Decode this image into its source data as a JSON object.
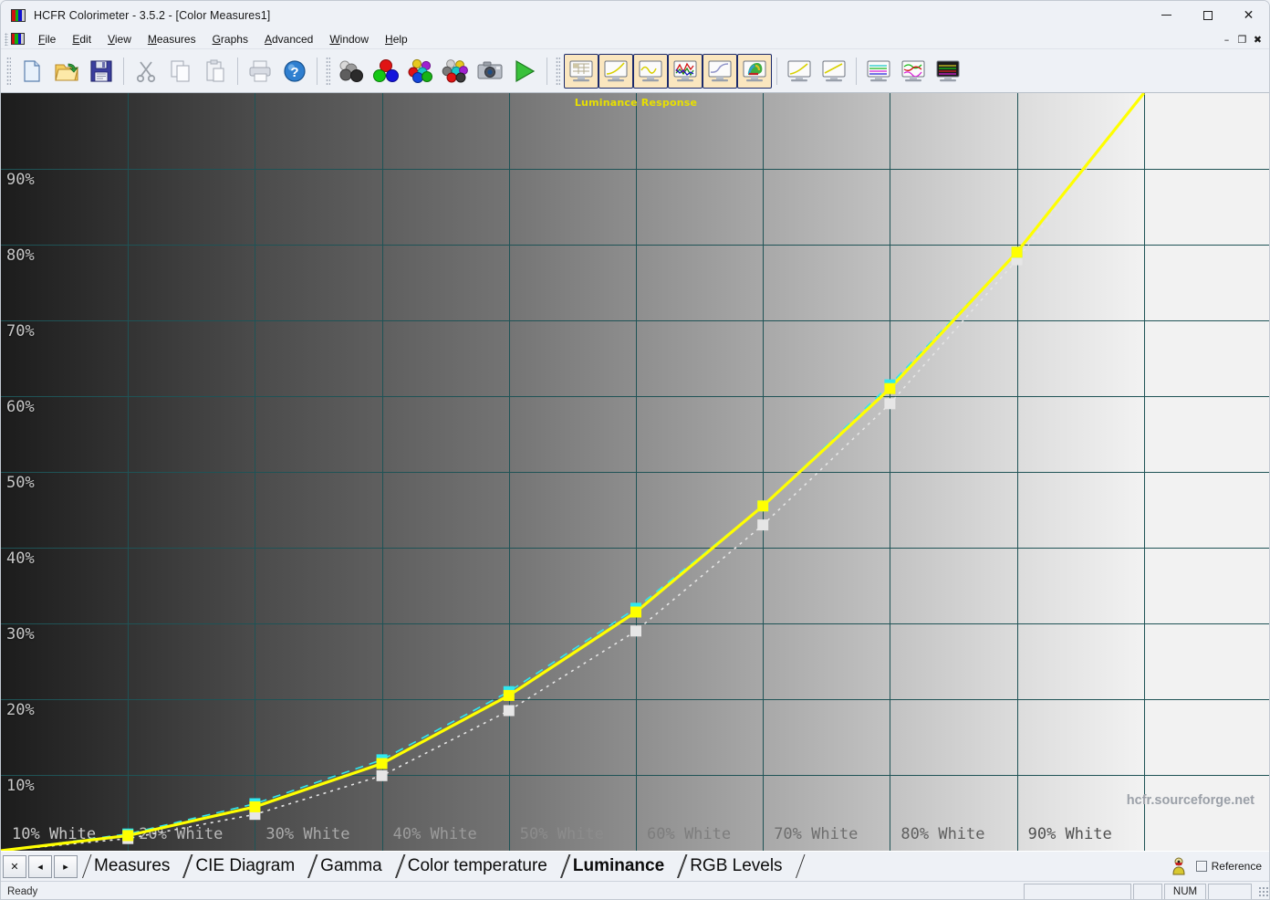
{
  "window": {
    "title": "HCFR Colorimeter - 3.5.2 - [Color Measures1]",
    "app_icon": "hcfr-rgb-icon",
    "minimize_label": "–",
    "maximize_label": "□",
    "close_label": "✕",
    "mdi_minimize_label": "–",
    "mdi_restore_label": "❐",
    "mdi_close_label": "✖"
  },
  "menu": {
    "items": [
      {
        "label": "File",
        "accel": "F"
      },
      {
        "label": "Edit",
        "accel": "E"
      },
      {
        "label": "View",
        "accel": "V"
      },
      {
        "label": "Measures",
        "accel": "M"
      },
      {
        "label": "Graphs",
        "accel": "G"
      },
      {
        "label": "Advanced",
        "accel": "A"
      },
      {
        "label": "Window",
        "accel": "W"
      },
      {
        "label": "Help",
        "accel": "H"
      }
    ]
  },
  "toolbar": {
    "groups": [
      {
        "buttons": [
          {
            "name": "new-document-button",
            "icon": "new-document-icon",
            "selected": false
          },
          {
            "name": "open-document-button",
            "icon": "open-folder-icon",
            "selected": false
          },
          {
            "name": "save-document-button",
            "icon": "floppy-save-icon",
            "selected": false
          }
        ]
      },
      {
        "buttons": [
          {
            "name": "cut-button",
            "icon": "scissors-icon",
            "selected": false
          },
          {
            "name": "copy-button",
            "icon": "copy-icon",
            "selected": false
          },
          {
            "name": "paste-button",
            "icon": "paste-icon",
            "selected": false
          }
        ]
      },
      {
        "buttons": [
          {
            "name": "print-button",
            "icon": "printer-icon",
            "selected": false
          },
          {
            "name": "help-button",
            "icon": "question-help-icon",
            "selected": false
          }
        ]
      },
      {
        "buttons": [
          {
            "name": "measure-grayscale-button",
            "icon": "grayscale-spheres-icon",
            "selected": false
          },
          {
            "name": "measure-primaries-button",
            "icon": "rgb-spheres-icon",
            "selected": false
          },
          {
            "name": "measure-saturations-button",
            "icon": "color-spheres-icon",
            "selected": false
          },
          {
            "name": "measure-full-button",
            "icon": "full-spheres-icon",
            "selected": false
          },
          {
            "name": "single-measure-button",
            "icon": "camera-icon",
            "selected": false
          },
          {
            "name": "run-continuous-button",
            "icon": "play-triangle-icon",
            "selected": false
          }
        ]
      },
      {
        "buttons": [
          {
            "name": "view-measures-grid-button",
            "icon": "monitor-grid-icon",
            "selected": true
          },
          {
            "name": "view-gamma-button",
            "icon": "monitor-curve-icon",
            "selected": true
          },
          {
            "name": "view-color-temp-button",
            "icon": "monitor-wave-icon",
            "selected": true
          },
          {
            "name": "view-rgb-levels-button",
            "icon": "monitor-multicurve-icon",
            "selected": true
          },
          {
            "name": "view-luminance-button",
            "icon": "monitor-softcurve-icon",
            "selected": true
          },
          {
            "name": "view-cie-diagram-button",
            "icon": "monitor-cie-icon",
            "selected": true
          }
        ]
      },
      {
        "buttons": [
          {
            "name": "graph-luminance-button",
            "icon": "monitor-yellow-curve-icon",
            "selected": false
          },
          {
            "name": "graph-gamma-button",
            "icon": "monitor-yellow-line-icon",
            "selected": false
          }
        ]
      },
      {
        "buttons": [
          {
            "name": "graph-rgb-flat-button",
            "icon": "monitor-rgb-flat-icon",
            "selected": false
          },
          {
            "name": "graph-rgb-wave-button",
            "icon": "monitor-rgb-wave-icon",
            "selected": false
          },
          {
            "name": "graph-rgb-full-button",
            "icon": "monitor-rgb-full-icon",
            "selected": false
          }
        ]
      }
    ]
  },
  "chart_data": {
    "type": "line",
    "title": "Luminance Response",
    "xlabel": "",
    "ylabel": "",
    "grid": true,
    "legend_position": "none",
    "watermark": "hcfr.sourceforge.net",
    "xlim": [
      0,
      100
    ],
    "ylim": [
      0,
      100
    ],
    "x_tick_labels": [
      "10% White",
      "20% White",
      "30% White",
      "40% White",
      "50% White",
      "60% White",
      "70% White",
      "80% White",
      "90% White"
    ],
    "y_tick_labels": [
      "10%",
      "20%",
      "30%",
      "40%",
      "50%",
      "60%",
      "70%",
      "80%",
      "90%"
    ],
    "y_ticks": [
      10,
      20,
      30,
      40,
      50,
      60,
      70,
      80,
      90
    ],
    "x": [
      0,
      10,
      20,
      30,
      40,
      50,
      60,
      70,
      80,
      90,
      100
    ],
    "series": [
      {
        "name": "measured-luminance",
        "color": "#ffff00",
        "style": "solid",
        "marker": "square",
        "values": [
          0,
          2.0,
          5.8,
          11.5,
          20.5,
          31.5,
          45.5,
          61.0,
          79.0,
          100.0
        ]
      },
      {
        "name": "reference-luminance",
        "color": "#30e8f0",
        "style": "dashed",
        "marker": "square",
        "values": [
          0,
          2.2,
          6.2,
          12.0,
          21.0,
          32.0,
          45.5,
          61.5,
          79.0,
          100.0
        ]
      },
      {
        "name": "gamma-reference",
        "color": "#e6e6e6",
        "style": "dotted",
        "marker": "square",
        "values": [
          0,
          1.6,
          4.8,
          9.9,
          18.5,
          29.0,
          43.0,
          59.0,
          78.0,
          100.0
        ]
      }
    ],
    "background_bands": [
      "#1c1c1c",
      "#333333",
      "#4b4b4b",
      "#5f5f5f",
      "#747474",
      "#8e8e8e",
      "#a8a8a8",
      "#c2c2c2",
      "#dcdcdc",
      "#f2f2f2"
    ]
  },
  "tabstrip": {
    "close_label": "✕",
    "prev_label": "◂",
    "next_label": "▸",
    "tabs": [
      {
        "label": "Measures",
        "active": false
      },
      {
        "label": "CIE Diagram",
        "active": false
      },
      {
        "label": "Gamma",
        "active": false
      },
      {
        "label": "Color temperature",
        "active": false
      },
      {
        "label": "Luminance",
        "active": true
      },
      {
        "label": "RGB Levels",
        "active": false
      }
    ],
    "helper_icon": "target-person-icon",
    "reference_label": "Reference",
    "reference_checked": false
  },
  "statusbar": {
    "message": "Ready",
    "panes": [
      "",
      "",
      "NUM",
      ""
    ]
  }
}
